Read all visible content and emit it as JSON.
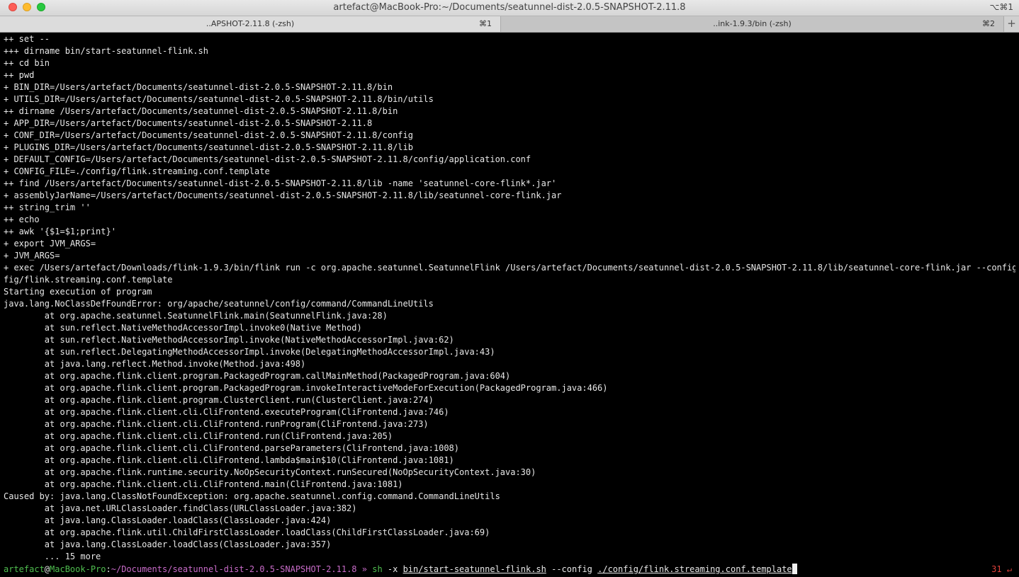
{
  "window": {
    "title": "artefact@MacBook-Pro:~/Documents/seatunnel-dist-2.0.5-SNAPSHOT-2.11.8",
    "shortcut": "⌥⌘1"
  },
  "tabs": [
    {
      "label": "..APSHOT-2.11.8 (-zsh)",
      "key": "⌘1",
      "active": true
    },
    {
      "label": "..ink-1.9.3/bin (-zsh)",
      "key": "⌘2",
      "active": false
    }
  ],
  "new_tab_label": "+",
  "output_lines": [
    "++ set --",
    "+++ dirname bin/start-seatunnel-flink.sh",
    "++ cd bin",
    "++ pwd",
    "+ BIN_DIR=/Users/artefact/Documents/seatunnel-dist-2.0.5-SNAPSHOT-2.11.8/bin",
    "+ UTILS_DIR=/Users/artefact/Documents/seatunnel-dist-2.0.5-SNAPSHOT-2.11.8/bin/utils",
    "++ dirname /Users/artefact/Documents/seatunnel-dist-2.0.5-SNAPSHOT-2.11.8/bin",
    "+ APP_DIR=/Users/artefact/Documents/seatunnel-dist-2.0.5-SNAPSHOT-2.11.8",
    "+ CONF_DIR=/Users/artefact/Documents/seatunnel-dist-2.0.5-SNAPSHOT-2.11.8/config",
    "+ PLUGINS_DIR=/Users/artefact/Documents/seatunnel-dist-2.0.5-SNAPSHOT-2.11.8/lib",
    "+ DEFAULT_CONFIG=/Users/artefact/Documents/seatunnel-dist-2.0.5-SNAPSHOT-2.11.8/config/application.conf",
    "+ CONFIG_FILE=./config/flink.streaming.conf.template",
    "++ find /Users/artefact/Documents/seatunnel-dist-2.0.5-SNAPSHOT-2.11.8/lib -name 'seatunnel-core-flink*.jar'",
    "+ assemblyJarName=/Users/artefact/Documents/seatunnel-dist-2.0.5-SNAPSHOT-2.11.8/lib/seatunnel-core-flink.jar",
    "++ string_trim ''",
    "++ echo",
    "++ awk '{$1=$1;print}'",
    "+ export JVM_ARGS=",
    "+ JVM_ARGS=",
    "+ exec /Users/artefact/Downloads/flink-1.9.3/bin/flink run -c org.apache.seatunnel.SeatunnelFlink /Users/artefact/Documents/seatunnel-dist-2.0.5-SNAPSHOT-2.11.8/lib/seatunnel-core-flink.jar --config ./con",
    "fig/flink.streaming.conf.template",
    "Starting execution of program",
    "java.lang.NoClassDefFoundError: org/apache/seatunnel/config/command/CommandLineUtils",
    "        at org.apache.seatunnel.SeatunnelFlink.main(SeatunnelFlink.java:28)",
    "        at sun.reflect.NativeMethodAccessorImpl.invoke0(Native Method)",
    "        at sun.reflect.NativeMethodAccessorImpl.invoke(NativeMethodAccessorImpl.java:62)",
    "        at sun.reflect.DelegatingMethodAccessorImpl.invoke(DelegatingMethodAccessorImpl.java:43)",
    "        at java.lang.reflect.Method.invoke(Method.java:498)",
    "        at org.apache.flink.client.program.PackagedProgram.callMainMethod(PackagedProgram.java:604)",
    "        at org.apache.flink.client.program.PackagedProgram.invokeInteractiveModeForExecution(PackagedProgram.java:466)",
    "        at org.apache.flink.client.program.ClusterClient.run(ClusterClient.java:274)",
    "        at org.apache.flink.client.cli.CliFrontend.executeProgram(CliFrontend.java:746)",
    "        at org.apache.flink.client.cli.CliFrontend.runProgram(CliFrontend.java:273)",
    "        at org.apache.flink.client.cli.CliFrontend.run(CliFrontend.java:205)",
    "        at org.apache.flink.client.cli.CliFrontend.parseParameters(CliFrontend.java:1008)",
    "        at org.apache.flink.client.cli.CliFrontend.lambda$main$10(CliFrontend.java:1081)",
    "        at org.apache.flink.runtime.security.NoOpSecurityContext.runSecured(NoOpSecurityContext.java:30)",
    "        at org.apache.flink.client.cli.CliFrontend.main(CliFrontend.java:1081)",
    "Caused by: java.lang.ClassNotFoundException: org.apache.seatunnel.config.command.CommandLineUtils",
    "        at java.net.URLClassLoader.findClass(URLClassLoader.java:382)",
    "        at java.lang.ClassLoader.loadClass(ClassLoader.java:424)",
    "        at org.apache.flink.util.ChildFirstClassLoader.loadClass(ChildFirstClassLoader.java:69)",
    "        at java.lang.ClassLoader.loadClass(ClassLoader.java:357)",
    "        ... 15 more"
  ],
  "prompt": {
    "user": "artefact",
    "at": "@",
    "host": "MacBook-Pro",
    "sep": ":",
    "path": "~/Documents/seatunnel-dist-2.0.5-SNAPSHOT-2.11.8",
    "arrow": " » ",
    "cmd": "sh",
    "flag": " -x ",
    "script": "bin/start-seatunnel-flink.sh",
    "opt": " --config ",
    "config": "./config/flink.streaming.conf.template"
  },
  "right_prompt": "31 ↵",
  "colors": {
    "prompt_green": "#4fbe4f",
    "prompt_magenta": "#c86bc8",
    "error_red": "#e0403a",
    "background": "#000000",
    "text": "#e8e8e8"
  }
}
